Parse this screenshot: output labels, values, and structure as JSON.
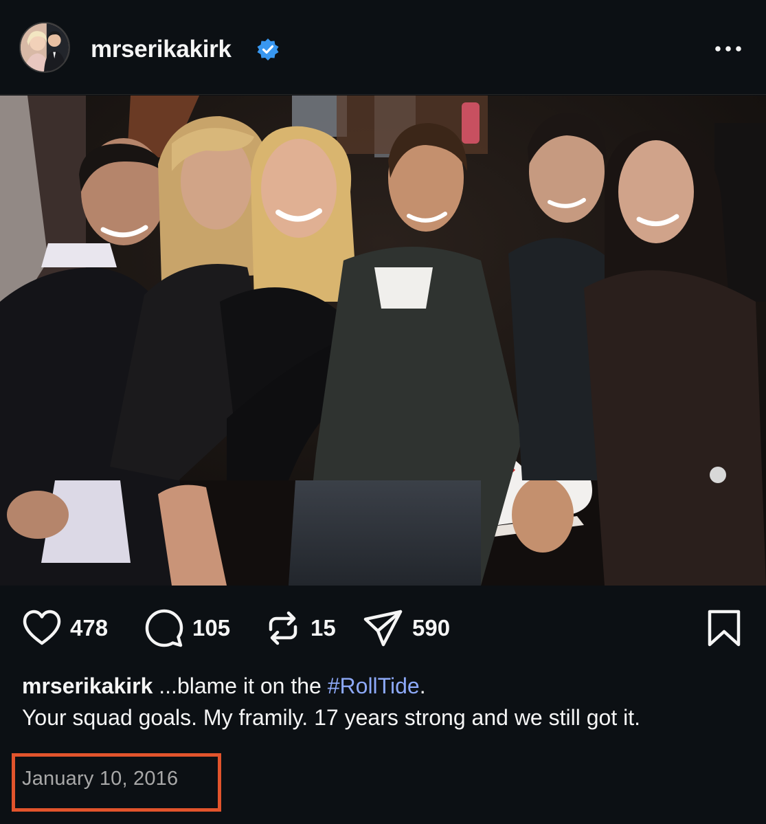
{
  "post": {
    "username": "mrserikakirk",
    "verified": true,
    "avatar_icon": "profile-avatar",
    "more_icon": "more-options-icon"
  },
  "actions": {
    "likes": "478",
    "comments": "105",
    "reposts": "15",
    "shares": "590"
  },
  "caption": {
    "username": "mrserikakirk",
    "text_before": " ...blame it on the ",
    "hashtag": "#RollTide",
    "text_after": ".",
    "line2": "Your squad goals. My framily. 17 years strong and we still got it."
  },
  "date": "January 10, 2016",
  "colors": {
    "background": "#0c1014",
    "hashtag": "#8da9f8",
    "verified": "#3897f0",
    "highlight_box": "#e2542c",
    "date_text": "#a8a8a8"
  }
}
